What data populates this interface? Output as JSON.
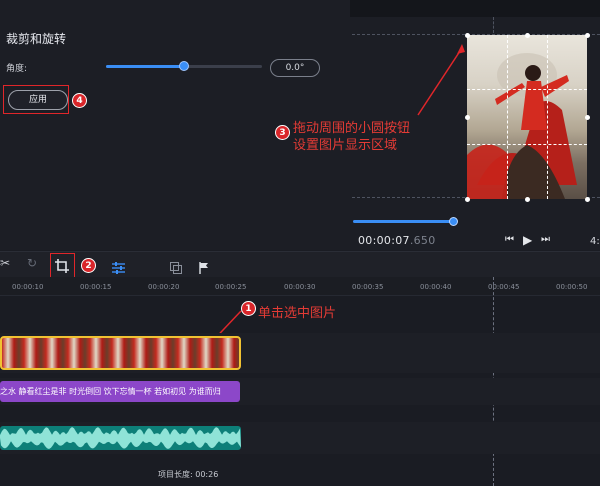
{
  "crop_panel": {
    "title": "裁剪和旋转",
    "angle_label": "角度:",
    "angle_value": "0.0°",
    "slider_level": 0.5,
    "apply_label": "应用"
  },
  "preview": {
    "timecode_main": "00:00:07",
    "timecode_ms": ".650",
    "duration_fragment": "4:",
    "hint_line1": "拖动周围的小圆按钮",
    "hint_line2": "设置图片显示区域"
  },
  "timeline": {
    "ticks": [
      "00:00:10",
      "00:00:15",
      "00:00:20",
      "00:00:25",
      "00:00:30",
      "00:00:35",
      "00:00:40",
      "00:00:45",
      "00:00:50"
    ],
    "text_clip": "之水 静看红尘是非 时光倒回 饮下忘情一杯 若如初见 为谁而归",
    "select_hint": "单击选中图片",
    "project_length_label": "项目长度:",
    "project_length_value": "00:26"
  },
  "badges": [
    "1",
    "2",
    "3",
    "4"
  ],
  "colors": {
    "accent": "#3a8ef5",
    "highlight": "#e0262a",
    "clip_border": "#f1c232",
    "text_clip": "#8c47c9",
    "audio_clip": "#0d7f78"
  },
  "icons": [
    "scissors-icon",
    "redo-icon",
    "crop-icon",
    "adjust-icon",
    "overlay-icon",
    "flag-icon",
    "skip-back-icon",
    "play-icon",
    "skip-forward-icon"
  ]
}
